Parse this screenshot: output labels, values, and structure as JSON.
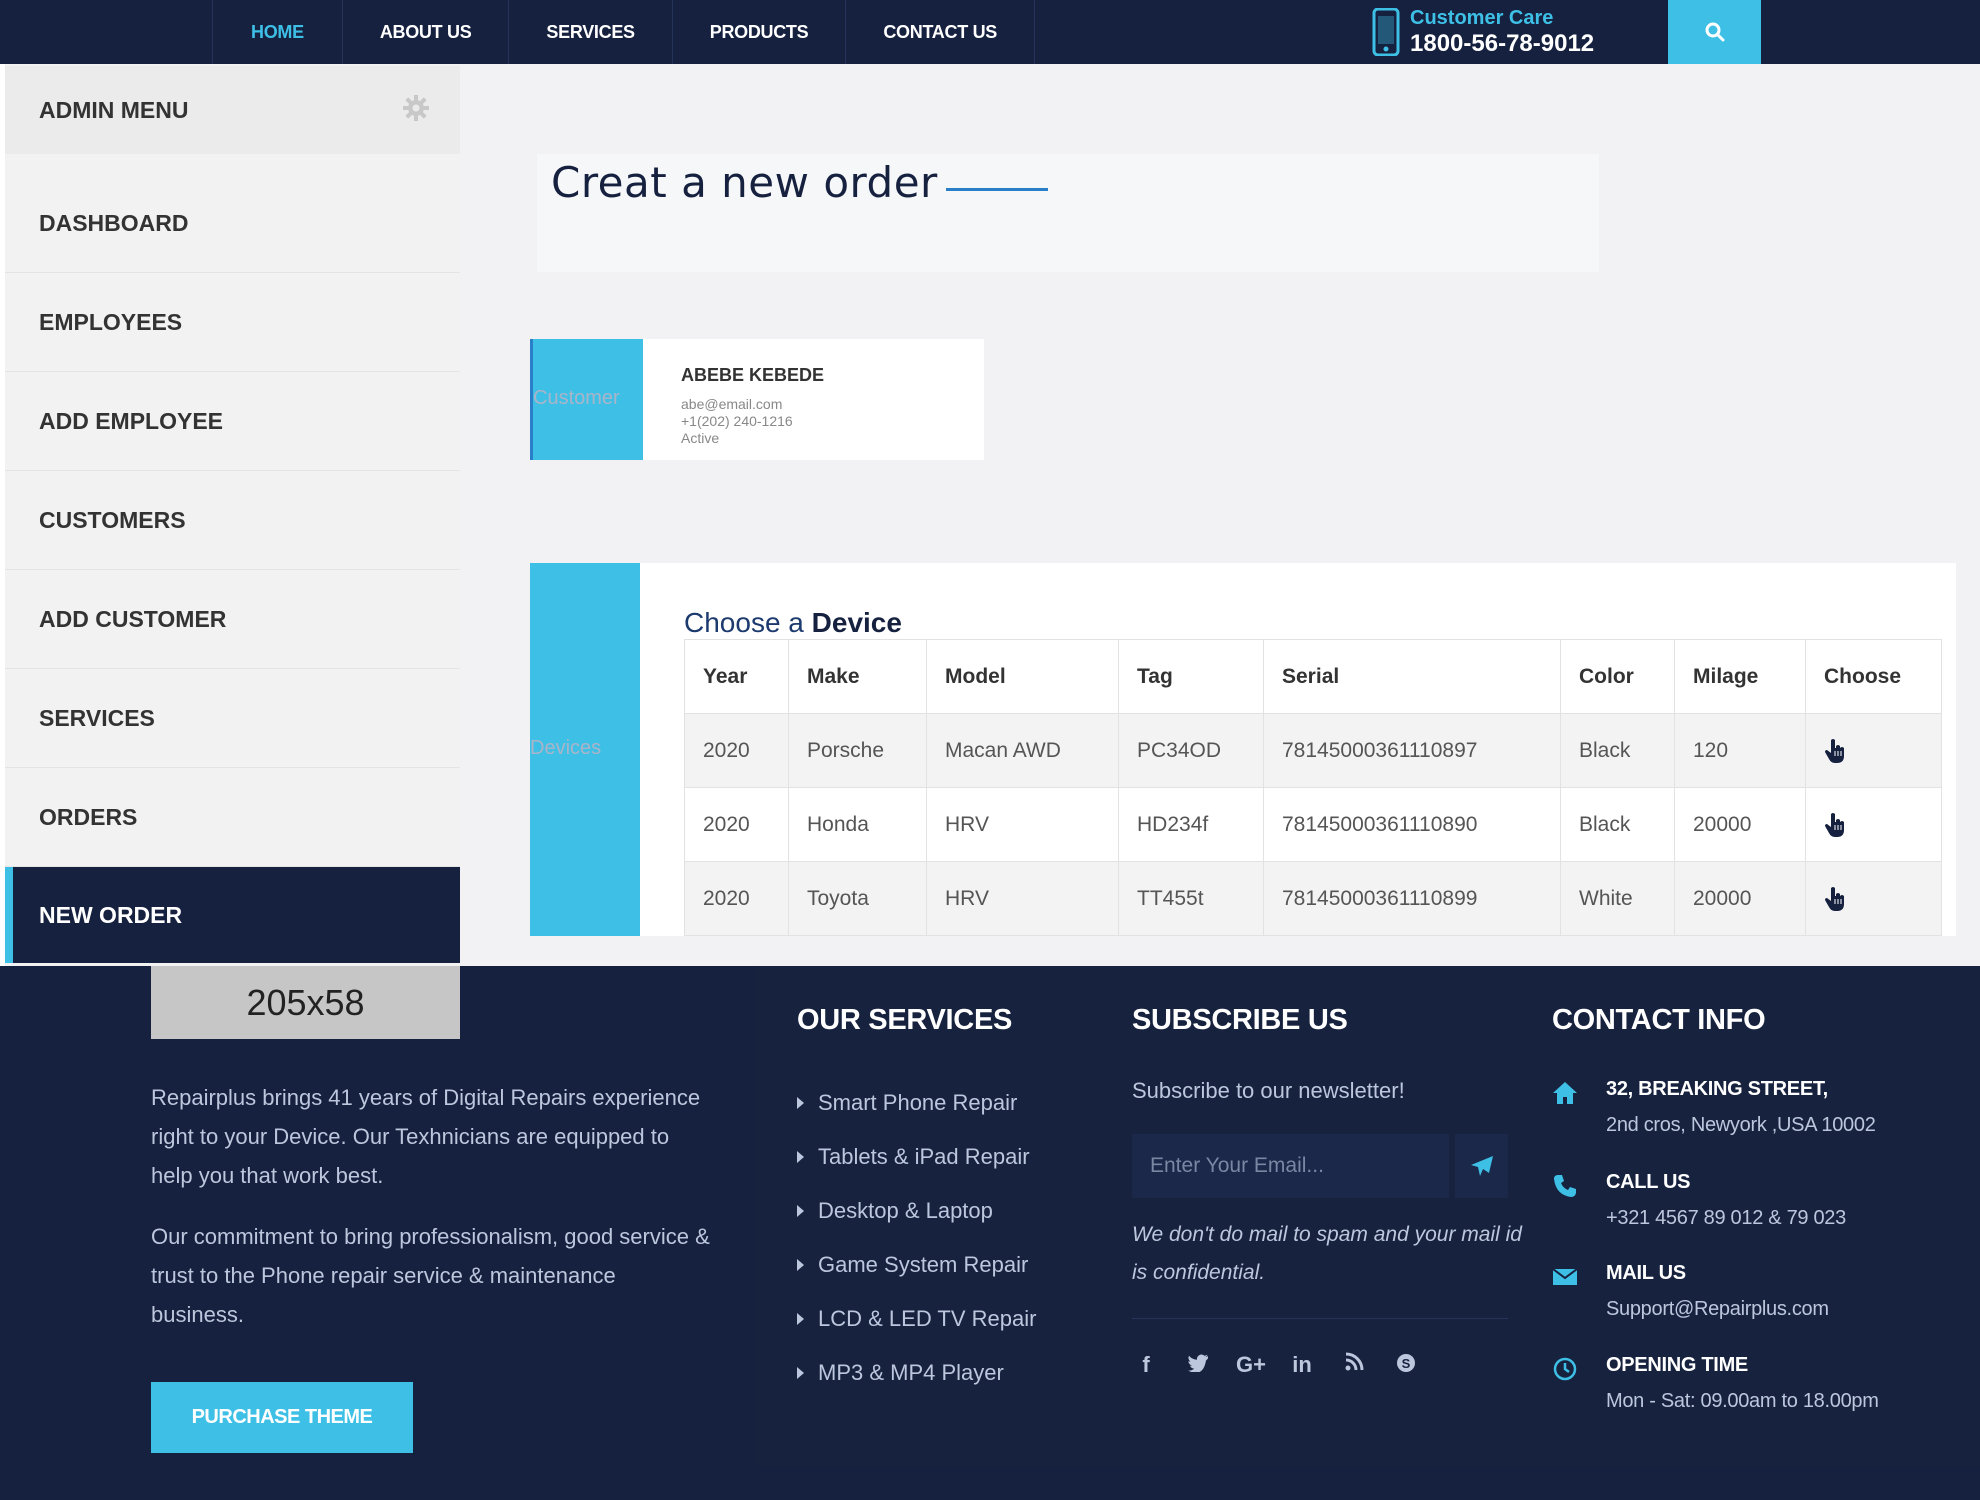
{
  "nav": {
    "items": [
      "HOME",
      "ABOUT US",
      "SERVICES",
      "PRODUCTS",
      "CONTACT US"
    ],
    "active": "HOME",
    "customer_care_label": "Customer Care",
    "customer_care_phone": "1800-56-78-9012"
  },
  "sidebar": {
    "title": "ADMIN MENU",
    "items": [
      {
        "label": "DASHBOARD"
      },
      {
        "label": "EMPLOYEES"
      },
      {
        "label": "ADD EMPLOYEE"
      },
      {
        "label": "CUSTOMERS"
      },
      {
        "label": "ADD CUSTOMER"
      },
      {
        "label": "SERVICES"
      },
      {
        "label": "ORDERS"
      },
      {
        "label": "NEW ORDER"
      }
    ],
    "active": "NEW ORDER"
  },
  "main": {
    "title": "Creat a new order",
    "customer_tab_label": "Customer",
    "customer": {
      "name": "ABEBE KEBEDE",
      "email": "abe@email.com",
      "phone": "+1(202) 240-1216",
      "status": "Active"
    },
    "devices_tab_label": "Devices",
    "devices_heading_prefix": "Choose a",
    "devices_heading_strong": "Device",
    "table": {
      "columns": [
        "Year",
        "Make",
        "Model",
        "Tag",
        "Serial",
        "Color",
        "Milage",
        "Choose"
      ],
      "rows": [
        [
          "2020",
          "Porsche",
          "Macan AWD",
          "PC34OD",
          "78145000361110897",
          "Black",
          "120"
        ],
        [
          "2020",
          "Honda",
          "HRV",
          "HD234f",
          "78145000361110890",
          "Black",
          "20000"
        ],
        [
          "2020",
          "Toyota",
          "HRV",
          "TT455t",
          "78145000361110899",
          "White",
          "20000"
        ]
      ]
    }
  },
  "footer": {
    "logo_placeholder": "205x58",
    "about_p1": "Repairplus brings 41 years of Digital Repairs experience right to your Device. Our Texhnicians are equipped to help you that work best.",
    "about_p2": "Our commitment to bring professionalism, good service & trust to the Phone repair service & maintenance business.",
    "purchase_label": "PURCHASE THEME",
    "services_title": "OUR SERVICES",
    "services": [
      "Smart Phone Repair",
      "Tablets & iPad Repair",
      "Desktop & Laptop",
      "Game System Repair",
      "LCD & LED TV Repair",
      "MP3 & MP4 Player"
    ],
    "subscribe_title": "SUBSCRIBE US",
    "subscribe_text": "Subscribe to our newsletter!",
    "email_placeholder": "Enter Your Email...",
    "spam_note": "We don't do mail to spam and your mail id is confidential.",
    "social_icons": [
      "facebook-icon",
      "twitter-icon",
      "google-plus-icon",
      "linkedin-icon",
      "rss-icon",
      "skype-icon"
    ],
    "contact_title": "CONTACT INFO",
    "address_line1": "32, BREAKING STREET,",
    "address_line2": "2nd cros, Newyork ,USA 10002",
    "call_head": "CALL US",
    "call_val": "+321 4567 89 012 & 79 023",
    "mail_head": "MAIL US",
    "mail_val": "Support@Repairplus.com",
    "open_head": "OPENING TIME",
    "open_val": "Mon - Sat: 09.00am to 18.00pm"
  },
  "colors": {
    "navy": "#16213f",
    "accent": "#3ec0e6",
    "sidebar_bg": "#f2f2f2"
  }
}
